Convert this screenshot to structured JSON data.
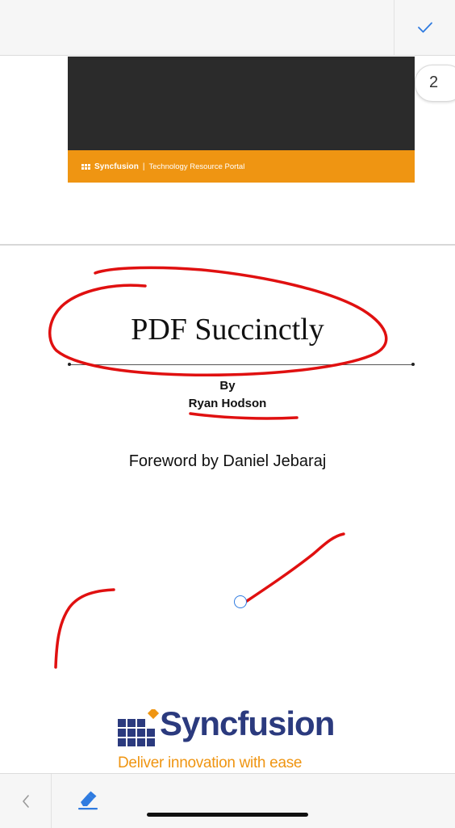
{
  "toolbar": {
    "confirm_icon": "checkmark-icon"
  },
  "page_badge": "2",
  "page1": {
    "brand": "Syncfusion",
    "divider": "|",
    "portal": "Technology Resource Portal"
  },
  "document": {
    "title": "PDF Succinctly",
    "by": "By",
    "author": "Ryan Hodson",
    "foreword": "Foreword by Daniel Jebaraj"
  },
  "logo": {
    "name": "Syncfusion",
    "tagline": "Deliver innovation with ease"
  },
  "bottom": {
    "back_icon": "chevron-left-icon",
    "tool_icon": "eraser-icon"
  },
  "colors": {
    "ink": "#e01010",
    "accent": "#2f7be0",
    "brand_orange": "#ef9512",
    "brand_navy": "#2b3a7e"
  }
}
